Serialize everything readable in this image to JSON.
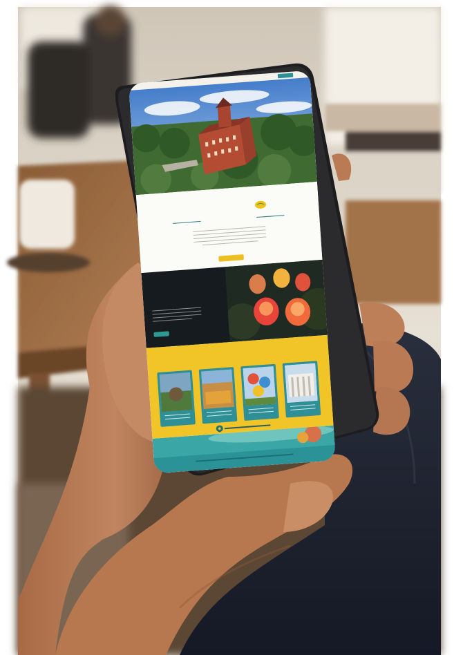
{
  "scene": {
    "colors": {
      "wall_light": "#e9e3d8",
      "table_wood": "#9a6c42",
      "phone_frame": "#1d1d1f",
      "skin": "#b87a52",
      "sleeve_dark": "#1d2230",
      "site_teal": "#2f8f97",
      "site_yellow": "#f1c427",
      "site_night": "#151b1f"
    }
  },
  "phone": {
    "screen_icons": [
      "menu-icon",
      "map-pin-icon",
      "lemon-icon"
    ],
    "sections": [
      "hero-photo",
      "intro",
      "night-balloons",
      "things-to-do",
      "footer"
    ]
  }
}
